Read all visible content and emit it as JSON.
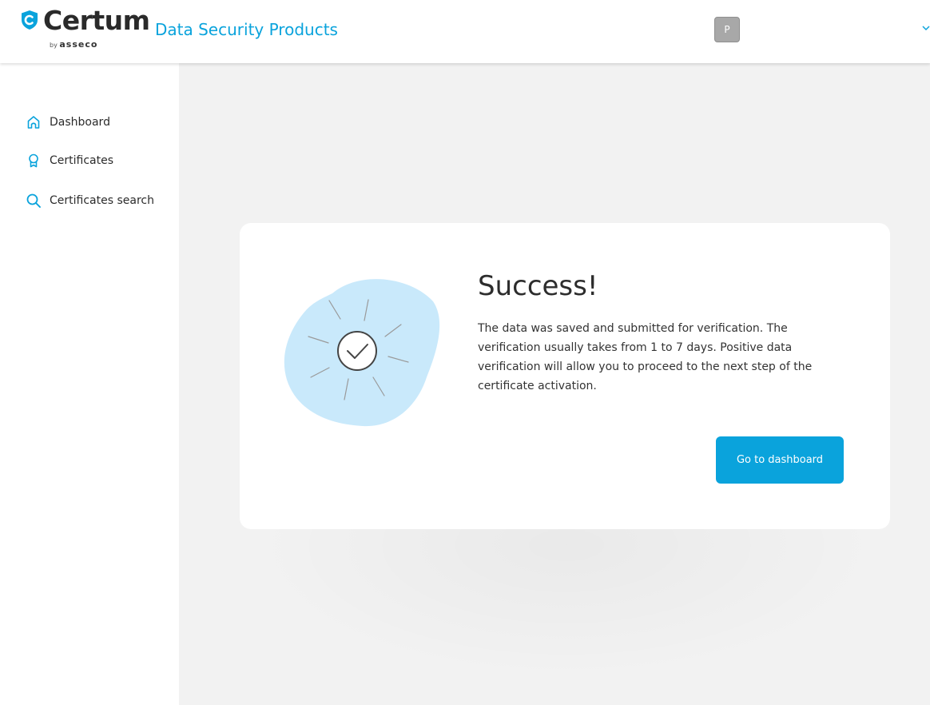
{
  "header": {
    "brand": "Certum",
    "by_text": "by",
    "asseco": "asseco",
    "product": "Data Security Products",
    "avatar_initial": "P"
  },
  "sidebar": {
    "items": [
      {
        "label": "Dashboard",
        "icon": "home-icon"
      },
      {
        "label": "Certificates",
        "icon": "certificate-icon"
      },
      {
        "label": "Certificates search",
        "icon": "search-icon"
      }
    ]
  },
  "main": {
    "title": "Success!",
    "message": "The data was saved and submitted for verification. The verification usually takes from 1 to 7 days. Positive data verification will allow you to proceed to the next step of the certificate activation.",
    "button_label": "Go to dashboard",
    "illustration": "success-check-icon"
  },
  "colors": {
    "accent": "#0aa3dc",
    "background": "#f2f2f2",
    "blob": "#c9e9fb",
    "avatar": "#a8a8a8"
  }
}
